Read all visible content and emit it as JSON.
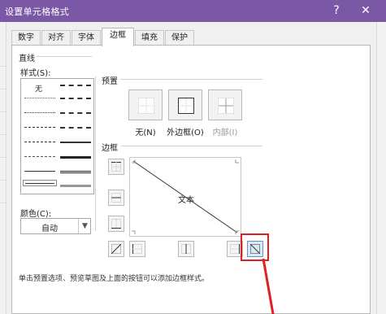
{
  "window": {
    "title": "设置单元格格式",
    "help_glyph": "?",
    "close_glyph": "✕"
  },
  "tabs": [
    {
      "label": "数字",
      "active": false
    },
    {
      "label": "对齐",
      "active": false
    },
    {
      "label": "字体",
      "active": false
    },
    {
      "label": "边框",
      "active": true
    },
    {
      "label": "填充",
      "active": false
    },
    {
      "label": "保护",
      "active": false
    }
  ],
  "line_section": {
    "label": "直线",
    "style_label": "样式(S):",
    "none_label": "无",
    "color_label": "颜色(C):",
    "color_value": "自动"
  },
  "presets": {
    "label": "预置",
    "items": [
      {
        "label": "无(N)",
        "disabled": false
      },
      {
        "label": "外边框(O)",
        "disabled": false
      },
      {
        "label": "内部(I)",
        "disabled": true
      }
    ]
  },
  "border": {
    "label": "边框",
    "preview_text": "文本",
    "selected_button": "diagonal-down-border-button"
  },
  "help_text": "单击预置选项、预览草图及上面的按钮可以添加边框样式。",
  "colors": {
    "title_bar": "#7a58a6",
    "highlight": "#e02020",
    "dialog_bg": "#f0f0f0"
  }
}
